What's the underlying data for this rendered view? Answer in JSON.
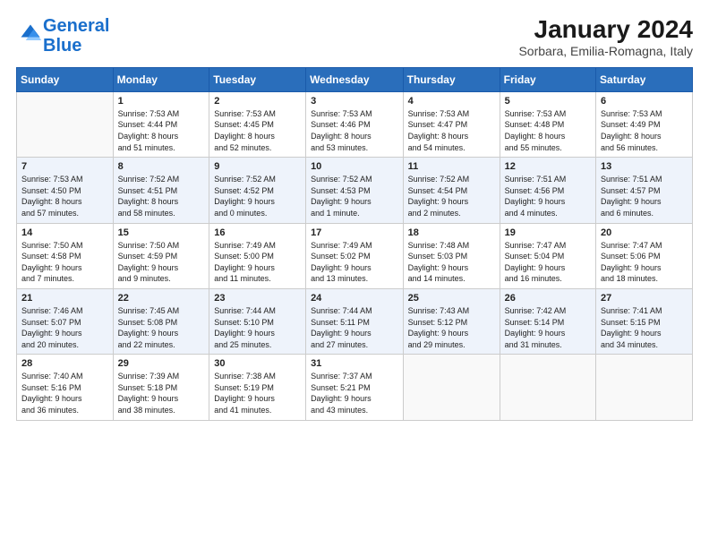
{
  "header": {
    "logo_line1": "General",
    "logo_line2": "Blue",
    "month": "January 2024",
    "location": "Sorbara, Emilia-Romagna, Italy"
  },
  "weekdays": [
    "Sunday",
    "Monday",
    "Tuesday",
    "Wednesday",
    "Thursday",
    "Friday",
    "Saturday"
  ],
  "weeks": [
    [
      {
        "day": "",
        "info": ""
      },
      {
        "day": "1",
        "info": "Sunrise: 7:53 AM\nSunset: 4:44 PM\nDaylight: 8 hours\nand 51 minutes."
      },
      {
        "day": "2",
        "info": "Sunrise: 7:53 AM\nSunset: 4:45 PM\nDaylight: 8 hours\nand 52 minutes."
      },
      {
        "day": "3",
        "info": "Sunrise: 7:53 AM\nSunset: 4:46 PM\nDaylight: 8 hours\nand 53 minutes."
      },
      {
        "day": "4",
        "info": "Sunrise: 7:53 AM\nSunset: 4:47 PM\nDaylight: 8 hours\nand 54 minutes."
      },
      {
        "day": "5",
        "info": "Sunrise: 7:53 AM\nSunset: 4:48 PM\nDaylight: 8 hours\nand 55 minutes."
      },
      {
        "day": "6",
        "info": "Sunrise: 7:53 AM\nSunset: 4:49 PM\nDaylight: 8 hours\nand 56 minutes."
      }
    ],
    [
      {
        "day": "7",
        "info": "Sunrise: 7:53 AM\nSunset: 4:50 PM\nDaylight: 8 hours\nand 57 minutes."
      },
      {
        "day": "8",
        "info": "Sunrise: 7:52 AM\nSunset: 4:51 PM\nDaylight: 8 hours\nand 58 minutes."
      },
      {
        "day": "9",
        "info": "Sunrise: 7:52 AM\nSunset: 4:52 PM\nDaylight: 9 hours\nand 0 minutes."
      },
      {
        "day": "10",
        "info": "Sunrise: 7:52 AM\nSunset: 4:53 PM\nDaylight: 9 hours\nand 1 minute."
      },
      {
        "day": "11",
        "info": "Sunrise: 7:52 AM\nSunset: 4:54 PM\nDaylight: 9 hours\nand 2 minutes."
      },
      {
        "day": "12",
        "info": "Sunrise: 7:51 AM\nSunset: 4:56 PM\nDaylight: 9 hours\nand 4 minutes."
      },
      {
        "day": "13",
        "info": "Sunrise: 7:51 AM\nSunset: 4:57 PM\nDaylight: 9 hours\nand 6 minutes."
      }
    ],
    [
      {
        "day": "14",
        "info": "Sunrise: 7:50 AM\nSunset: 4:58 PM\nDaylight: 9 hours\nand 7 minutes."
      },
      {
        "day": "15",
        "info": "Sunrise: 7:50 AM\nSunset: 4:59 PM\nDaylight: 9 hours\nand 9 minutes."
      },
      {
        "day": "16",
        "info": "Sunrise: 7:49 AM\nSunset: 5:00 PM\nDaylight: 9 hours\nand 11 minutes."
      },
      {
        "day": "17",
        "info": "Sunrise: 7:49 AM\nSunset: 5:02 PM\nDaylight: 9 hours\nand 13 minutes."
      },
      {
        "day": "18",
        "info": "Sunrise: 7:48 AM\nSunset: 5:03 PM\nDaylight: 9 hours\nand 14 minutes."
      },
      {
        "day": "19",
        "info": "Sunrise: 7:47 AM\nSunset: 5:04 PM\nDaylight: 9 hours\nand 16 minutes."
      },
      {
        "day": "20",
        "info": "Sunrise: 7:47 AM\nSunset: 5:06 PM\nDaylight: 9 hours\nand 18 minutes."
      }
    ],
    [
      {
        "day": "21",
        "info": "Sunrise: 7:46 AM\nSunset: 5:07 PM\nDaylight: 9 hours\nand 20 minutes."
      },
      {
        "day": "22",
        "info": "Sunrise: 7:45 AM\nSunset: 5:08 PM\nDaylight: 9 hours\nand 22 minutes."
      },
      {
        "day": "23",
        "info": "Sunrise: 7:44 AM\nSunset: 5:10 PM\nDaylight: 9 hours\nand 25 minutes."
      },
      {
        "day": "24",
        "info": "Sunrise: 7:44 AM\nSunset: 5:11 PM\nDaylight: 9 hours\nand 27 minutes."
      },
      {
        "day": "25",
        "info": "Sunrise: 7:43 AM\nSunset: 5:12 PM\nDaylight: 9 hours\nand 29 minutes."
      },
      {
        "day": "26",
        "info": "Sunrise: 7:42 AM\nSunset: 5:14 PM\nDaylight: 9 hours\nand 31 minutes."
      },
      {
        "day": "27",
        "info": "Sunrise: 7:41 AM\nSunset: 5:15 PM\nDaylight: 9 hours\nand 34 minutes."
      }
    ],
    [
      {
        "day": "28",
        "info": "Sunrise: 7:40 AM\nSunset: 5:16 PM\nDaylight: 9 hours\nand 36 minutes."
      },
      {
        "day": "29",
        "info": "Sunrise: 7:39 AM\nSunset: 5:18 PM\nDaylight: 9 hours\nand 38 minutes."
      },
      {
        "day": "30",
        "info": "Sunrise: 7:38 AM\nSunset: 5:19 PM\nDaylight: 9 hours\nand 41 minutes."
      },
      {
        "day": "31",
        "info": "Sunrise: 7:37 AM\nSunset: 5:21 PM\nDaylight: 9 hours\nand 43 minutes."
      },
      {
        "day": "",
        "info": ""
      },
      {
        "day": "",
        "info": ""
      },
      {
        "day": "",
        "info": ""
      }
    ]
  ]
}
